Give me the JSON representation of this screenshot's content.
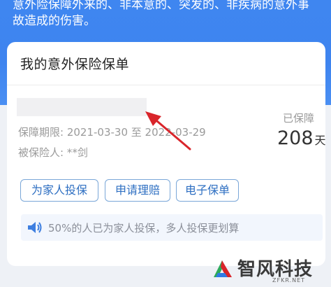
{
  "banner": {
    "text": "意外险保障外来的、非本意的、突发的、非疾病的意外事故造成的伤害。"
  },
  "card": {
    "title": "我的意外保险保单",
    "period": "保障期限: 2021-03-30 至 2022-03-29",
    "insured": "被保险人: **剑",
    "status_label": "已保障",
    "days_value": "208",
    "days_unit": "天"
  },
  "actions": {
    "family": "为家人投保",
    "claim": "申请理赔",
    "epolicy": "电子保单"
  },
  "notice": {
    "text": "50%的人已为家人投保，多人投保更划算",
    "icon": "speaker-icon"
  },
  "watermark": {
    "text": "智风科技",
    "sub": "ZFKR.NET"
  },
  "colors": {
    "banner": "#3e84ef",
    "accent": "#2e6fc2",
    "arrow": "#d9252b"
  }
}
